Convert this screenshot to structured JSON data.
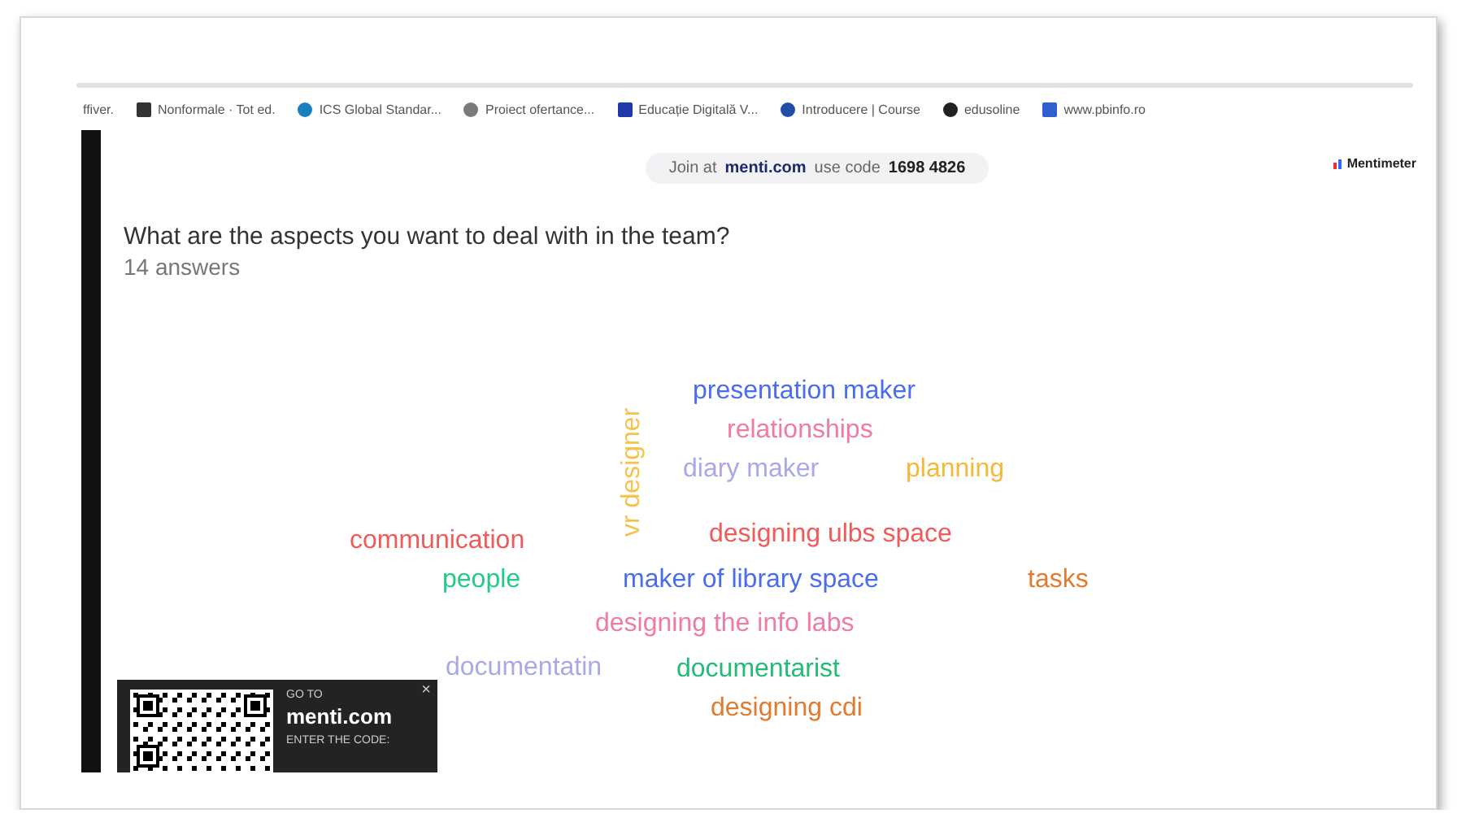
{
  "bookmarks": [
    {
      "label": "ffiver."
    },
    {
      "label": "Nonformale · Tot ed."
    },
    {
      "label": "ICS Global Standar..."
    },
    {
      "label": "Proiect ofertance..."
    },
    {
      "label": "Educație Digitală V..."
    },
    {
      "label": "Introducere | Course"
    },
    {
      "label": "edusoline"
    },
    {
      "label": "www.pbinfo.ro"
    }
  ],
  "join_bar": {
    "prefix": "Join at",
    "site": "menti.com",
    "code_label": "use code",
    "code": "1698 4826"
  },
  "brand": "Mentimeter",
  "question": "What are the aspects you want to deal with in the team?",
  "answer_count": "14 answers",
  "words": [
    {
      "text": "presentation maker",
      "color": "#4a6cf0",
      "kind": "horizontal"
    },
    {
      "text": "relationships",
      "color": "#f07aa8",
      "kind": "horizontal"
    },
    {
      "text": "diary maker",
      "color": "#a9a8e8",
      "kind": "horizontal"
    },
    {
      "text": "planning",
      "color": "#f5b93a",
      "kind": "horizontal"
    },
    {
      "text": "vr designer",
      "color": "#f5c34a",
      "kind": "vertical"
    },
    {
      "text": "communication",
      "color": "#f25a5a",
      "kind": "horizontal"
    },
    {
      "text": "designing ulbs space",
      "color": "#f25a5a",
      "kind": "horizontal"
    },
    {
      "text": "people",
      "color": "#22cc88",
      "kind": "horizontal"
    },
    {
      "text": "maker of library space",
      "color": "#4a6cf0",
      "kind": "horizontal"
    },
    {
      "text": "tasks",
      "color": "#e07b30",
      "kind": "horizontal"
    },
    {
      "text": "designing the info labs",
      "color": "#f07aa8",
      "kind": "horizontal"
    },
    {
      "text": "documentatin",
      "color": "#a9a8e8",
      "kind": "horizontal"
    },
    {
      "text": "documentarist",
      "color": "#22bb77",
      "kind": "horizontal"
    },
    {
      "text": "designing cdi",
      "color": "#e07b30",
      "kind": "horizontal"
    }
  ],
  "qr_popup": {
    "go_to": "GO TO",
    "site": "menti.com",
    "enter": "ENTER THE CODE:",
    "close": "×"
  }
}
